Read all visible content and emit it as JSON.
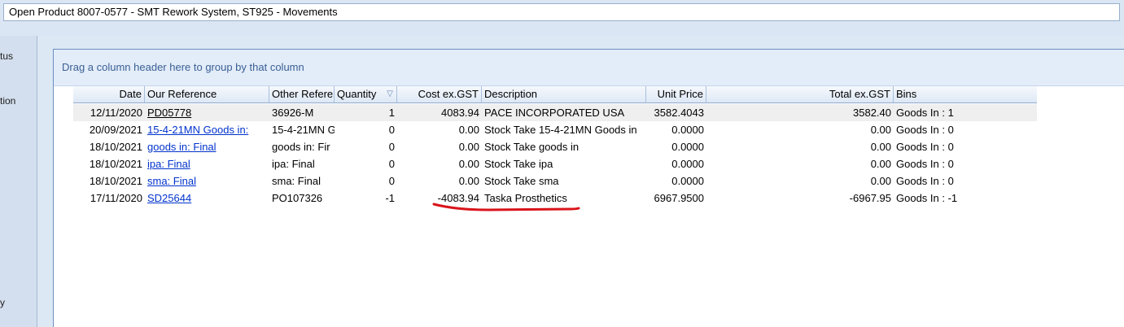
{
  "window": {
    "title": "Open Product 8007-0577 - SMT Rework System, ST925 - Movements"
  },
  "sidebar": {
    "items": [
      "tus",
      "tion",
      "y"
    ]
  },
  "grid": {
    "group_hint": "Drag a column header here to group by that column",
    "columns": {
      "date": "Date",
      "our_ref": "Our Reference",
      "other_ref": "Other Reference",
      "quantity": "Quantity",
      "cost": "Cost ex.GST",
      "description": "Description",
      "unit_price": "Unit Price",
      "total": "Total ex.GST",
      "bins": "Bins"
    },
    "sort_icon": "sort-descending-icon",
    "rows": [
      {
        "date": "12/11/2020",
        "our_ref": "PD05778",
        "other_ref": "36926-M",
        "quantity": "1",
        "cost": "4083.94",
        "description": "PACE INCORPORATED USA",
        "unit_price": "3582.4043",
        "total": "3582.40",
        "bins": "Goods In : 1"
      },
      {
        "date": "20/09/2021",
        "our_ref": "15-4-21MN Goods in:",
        "other_ref": "15-4-21MN G",
        "quantity": "0",
        "cost": "0.00",
        "description": "Stock Take 15-4-21MN Goods in",
        "unit_price": "0.0000",
        "total": "0.00",
        "bins": "Goods In : 0"
      },
      {
        "date": "18/10/2021",
        "our_ref": "goods  in: Final",
        "other_ref": "goods  in: Fir",
        "quantity": "0",
        "cost": "0.00",
        "description": "Stock Take goods  in",
        "unit_price": "0.0000",
        "total": "0.00",
        "bins": "Goods In : 0"
      },
      {
        "date": "18/10/2021",
        "our_ref": "ipa: Final",
        "other_ref": "ipa: Final",
        "quantity": "0",
        "cost": "0.00",
        "description": "Stock Take ipa",
        "unit_price": "0.0000",
        "total": "0.00",
        "bins": "Goods In : 0"
      },
      {
        "date": "18/10/2021",
        "our_ref": "sma: Final",
        "other_ref": "sma: Final",
        "quantity": "0",
        "cost": "0.00",
        "description": "Stock Take sma",
        "unit_price": "0.0000",
        "total": "0.00",
        "bins": "Goods In : 0"
      },
      {
        "date": "17/11/2020",
        "our_ref": "SD25644",
        "other_ref": "PO107326",
        "quantity": "-1",
        "cost": "-4083.94",
        "description": "Taska Prosthetics",
        "unit_price": "6967.9500",
        "total": "-6967.95",
        "bins": "Goods In : -1"
      }
    ]
  },
  "annotation": {
    "color": "#d9141b"
  }
}
